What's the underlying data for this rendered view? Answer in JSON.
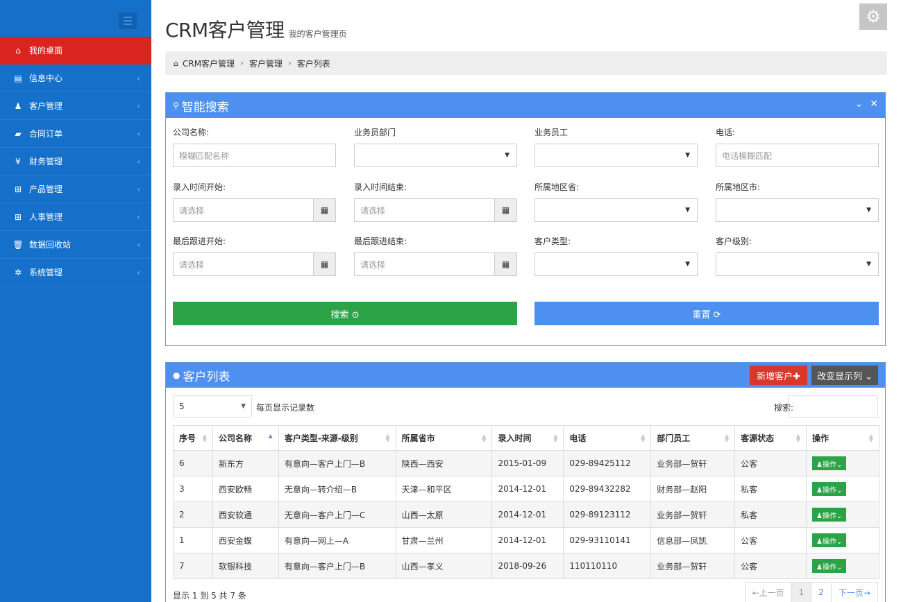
{
  "sidebar": {
    "items": [
      {
        "label": "我的桌面",
        "icon": "home-icon",
        "glyph": "⌂",
        "active": true
      },
      {
        "label": "信息中心",
        "icon": "desktop-icon",
        "glyph": "▤"
      },
      {
        "label": "客户管理",
        "icon": "user-icon",
        "glyph": "♟"
      },
      {
        "label": "合同订单",
        "icon": "book-icon",
        "glyph": "▰"
      },
      {
        "label": "财务管理",
        "icon": "yen-icon",
        "glyph": "¥"
      },
      {
        "label": "产品管理",
        "icon": "table-icon",
        "glyph": "⊞"
      },
      {
        "label": "人事管理",
        "icon": "table-icon",
        "glyph": "⊞"
      },
      {
        "label": "数据回收站",
        "icon": "trash-icon",
        "glyph": "🗑"
      },
      {
        "label": "系统管理",
        "icon": "cog-icon",
        "glyph": "✲"
      }
    ],
    "chevron": "‹"
  },
  "header": {
    "title": "CRM客户管理",
    "subtitle": "我的客户管理页",
    "gear": "⚙"
  },
  "breadcrumb": {
    "home_glyph": "⌂",
    "items": [
      "CRM客户管理",
      "客户管理",
      "客户列表"
    ],
    "sep": "›"
  },
  "search_panel": {
    "title": "智能搜索",
    "search_glyph": "⚲",
    "tools": [
      "⌄",
      "✕"
    ],
    "fields": {
      "company": {
        "label": "公司名称:",
        "placeholder": "模糊匹配名称"
      },
      "dept": {
        "label": "业务员部门",
        "value": ""
      },
      "staff": {
        "label": "业务员工",
        "value": ""
      },
      "phone": {
        "label": "电话:",
        "placeholder": "电话模糊匹配"
      },
      "entry_start": {
        "label": "录入时间开始:",
        "placeholder": "请选择"
      },
      "entry_end": {
        "label": "录入时间结束:",
        "placeholder": "请选择"
      },
      "province": {
        "label": "所属地区省:",
        "value": ""
      },
      "city": {
        "label": "所属地区市:",
        "value": ""
      },
      "follow_start": {
        "label": "最后跟进开始:",
        "placeholder": "请选择"
      },
      "follow_end": {
        "label": "最后跟进结束:",
        "placeholder": "请选择"
      },
      "cust_type": {
        "label": "客户类型:",
        "value": ""
      },
      "cust_level": {
        "label": "客户级别:",
        "value": ""
      }
    },
    "calendar_glyph": "▦",
    "caret": "▼",
    "search_btn": "搜索 ⊙",
    "reset_btn": "重置 ⟳"
  },
  "list_panel": {
    "title": "客户列表",
    "title_glyph": "●",
    "add_btn": "新增客户✚",
    "cols_btn": "改变显示列 ⌄",
    "page_len": "5",
    "page_len_label": "每页显示记录数",
    "search_label": "搜索:",
    "columns": [
      "序号",
      "公司名称",
      "客户类型-来源-级别",
      "所属省市",
      "录入时间",
      "电话",
      "部门员工",
      "客源状态",
      "操作"
    ],
    "rows": [
      [
        "6",
        "新东方",
        "有意向—客户上门—B",
        "陕西—西安",
        "2015-01-09",
        "029-89425112",
        "业务部—贺轩",
        "公客"
      ],
      [
        "3",
        "西安欧畅",
        "无意向—转介绍—B",
        "天津—和平区",
        "2014-12-01",
        "029-89432282",
        "财务部—赵阳",
        "私客"
      ],
      [
        "2",
        "西安软通",
        "无意向—客户上门—C",
        "山西—太原",
        "2014-12-01",
        "029-89123112",
        "业务部—贺轩",
        "私客"
      ],
      [
        "1",
        "西安金蝶",
        "有意向—网上—A",
        "甘肃—兰州",
        "2014-12-01",
        "029-93110141",
        "信息部—凤凯",
        "公客"
      ],
      [
        "7",
        "软银科技",
        "有意向—客户上门—B",
        "山西—孝义",
        "2018-09-26",
        "110110110",
        "业务部—贺轩",
        "公客"
      ]
    ],
    "op_label": "♟操作⌄",
    "info": "显示 1 到 5 共 7 条",
    "pager": {
      "prev": "←上一页",
      "pages": [
        "1",
        "2"
      ],
      "next": "下一页→"
    }
  },
  "colors": {
    "sidebar": "#1570c9",
    "active": "#d9241f",
    "panel_head": "#4d90f0",
    "success": "#2ba346",
    "danger": "#d9362c"
  }
}
